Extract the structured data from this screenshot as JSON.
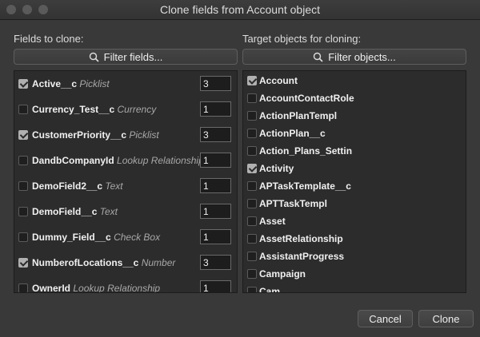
{
  "window": {
    "title": "Clone fields from Account object"
  },
  "fields_panel": {
    "label": "Fields to clone:",
    "filter_label": "Filter fields...",
    "items": [
      {
        "name": "Active__c",
        "type": "Picklist",
        "checked": true,
        "value": "3"
      },
      {
        "name": "Currency_Test__c",
        "type": "Currency",
        "checked": false,
        "value": "1"
      },
      {
        "name": "CustomerPriority__c",
        "type": "Picklist",
        "checked": true,
        "value": "3"
      },
      {
        "name": "DandbCompanyId",
        "type": "Lookup Relationship",
        "checked": false,
        "value": "1"
      },
      {
        "name": "DemoField2__c",
        "type": "Text",
        "checked": false,
        "value": "1"
      },
      {
        "name": "DemoField__c",
        "type": "Text",
        "checked": false,
        "value": "1"
      },
      {
        "name": "Dummy_Field__c",
        "type": "Check Box",
        "checked": false,
        "value": "1"
      },
      {
        "name": "NumberofLocations__c",
        "type": "Number",
        "checked": true,
        "value": "3"
      },
      {
        "name": "OwnerId",
        "type": "Lookup Relationship",
        "checked": false,
        "value": "1"
      }
    ]
  },
  "objects_panel": {
    "label": "Target objects for cloning:",
    "filter_label": "Filter objects...",
    "items": [
      {
        "name": "Account",
        "checked": true
      },
      {
        "name": "AccountContactRole",
        "checked": false
      },
      {
        "name": "ActionPlanTempl",
        "checked": false
      },
      {
        "name": "ActionPlan__c",
        "checked": false
      },
      {
        "name": "Action_Plans_Settin",
        "checked": false
      },
      {
        "name": "Activity",
        "checked": true
      },
      {
        "name": "APTaskTemplate__c",
        "checked": false
      },
      {
        "name": "APTTaskTempl",
        "checked": false
      },
      {
        "name": "Asset",
        "checked": false
      },
      {
        "name": "AssetRelationship",
        "checked": false
      },
      {
        "name": "AssistantProgress",
        "checked": false
      },
      {
        "name": "Campaign",
        "checked": false
      },
      {
        "name": "Cam...",
        "checked": false
      }
    ]
  },
  "buttons": {
    "cancel": "Cancel",
    "clone": "Clone"
  },
  "colors": {
    "background": "#393939",
    "list_background": "#2c2c2c",
    "text": "#f0f0f0",
    "type_text": "#a8a8a8"
  },
  "icons": {
    "filter": "search-icon"
  }
}
